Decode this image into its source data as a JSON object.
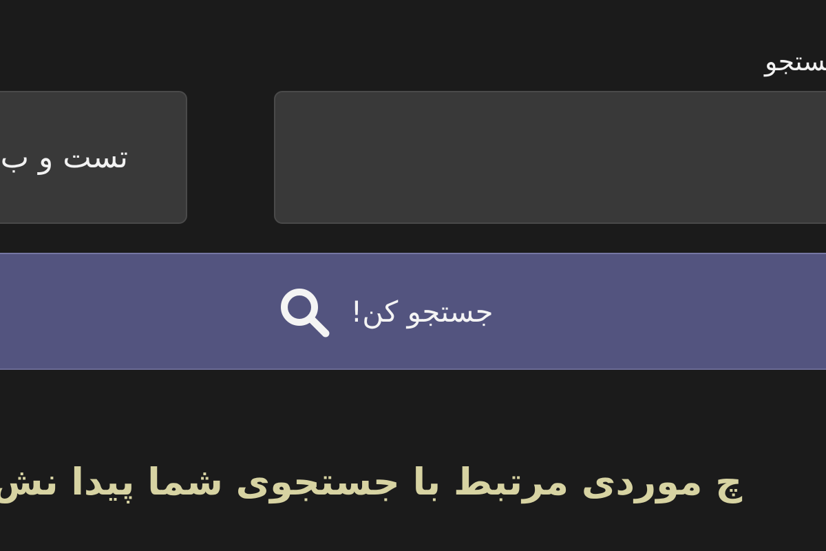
{
  "search": {
    "label": "جستجو",
    "input_value": "",
    "placeholder": ""
  },
  "category": {
    "selected_value": "تست و ب"
  },
  "search_button": {
    "label": "جستجو کن!",
    "icon": "search-icon"
  },
  "results": {
    "empty_message": "چ موردی مرتبط با جستجوی شما پیدا نش"
  },
  "colors": {
    "background": "#1b1b1b",
    "field_background": "#393939",
    "button_background": "#53547f",
    "message_text": "#d7d3a2"
  }
}
